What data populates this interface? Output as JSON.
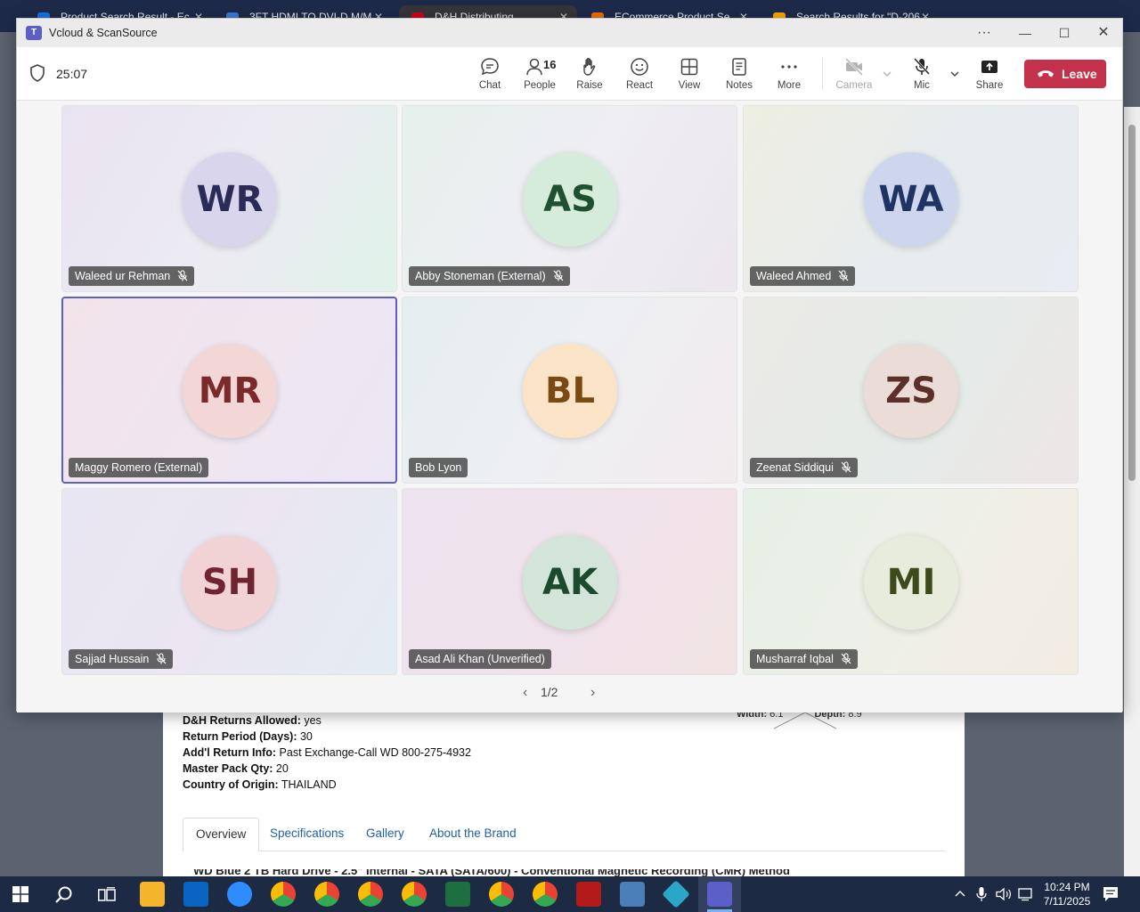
{
  "browser": {
    "tabs": [
      {
        "title": "Product Search Result - Ec",
        "color": "#1a73e8"
      },
      {
        "title": "3FT HDMI TO DVI-D M/M",
        "color": "#3a7bd5"
      },
      {
        "title": "D&H Distributing",
        "color": "#d0021b"
      },
      {
        "title": "ECommerce Product Se",
        "color": "#e8710a"
      },
      {
        "title": "Search Results for \"D-206",
        "color": "#f9ab00"
      }
    ]
  },
  "product_page": {
    "specs": [
      {
        "label": "D&H Returns Allowed:",
        "value": "yes"
      },
      {
        "label": "Return Period (Days):",
        "value": "30"
      },
      {
        "label": "Add'l Return Info:",
        "value": "Past Exchange-Call WD 800-275-4932"
      },
      {
        "label": "Master Pack Qty:",
        "value": "20"
      },
      {
        "label": "Country of Origin:",
        "value": "THAILAND"
      }
    ],
    "dimensions": {
      "width_label": "Width:",
      "width_value": "6.1\"",
      "depth_label": "Depth:",
      "depth_value": "8.9\""
    },
    "tabs": [
      "Overview",
      "Specifications",
      "Gallery",
      "About the Brand"
    ],
    "cut_title": "WD Blue 2 TB Hard Drive - 2.5\" Internal - SATA (SATA/600) - Conventional Magnetic Recording (CMR) Method"
  },
  "teams": {
    "window_title": "Vcloud & ScanSource",
    "more_options": "···",
    "timer": "25:07",
    "toolbar": {
      "chat": "Chat",
      "people": "People",
      "people_count": "16",
      "raise": "Raise",
      "react": "React",
      "view": "View",
      "notes": "Notes",
      "more": "More",
      "camera": "Camera",
      "mic": "Mic",
      "share": "Share",
      "leave": "Leave"
    },
    "participants": [
      {
        "initials": "WR",
        "name": "Waleed ur Rehman",
        "muted": true,
        "bg": "#d8d5ec",
        "fg": "#2b2b57"
      },
      {
        "initials": "AS",
        "name": "Abby Stoneman (External)",
        "muted": true,
        "bg": "#d4ecd9",
        "fg": "#1f5131"
      },
      {
        "initials": "WA",
        "name": "Waleed Ahmed",
        "muted": true,
        "bg": "#cdd6ec",
        "fg": "#1f3463"
      },
      {
        "initials": "MR",
        "name": "Maggy Romero (External)",
        "muted": false,
        "bg": "#f3d6d6",
        "fg": "#7a2a2a"
      },
      {
        "initials": "BL",
        "name": "Bob Lyon",
        "muted": false,
        "bg": "#fbe3c8",
        "fg": "#7a4a14"
      },
      {
        "initials": "ZS",
        "name": "Zeenat Siddiqui",
        "muted": true,
        "bg": "#ecdcd8",
        "fg": "#5a3029"
      },
      {
        "initials": "SH",
        "name": "Sajjad Hussain",
        "muted": true,
        "bg": "#f1d3d6",
        "fg": "#6e2431"
      },
      {
        "initials": "AK",
        "name": "Asad Ali Khan (Unverified)",
        "muted": false,
        "bg": "#d2e5d8",
        "fg": "#1d4a2c"
      },
      {
        "initials": "MI",
        "name": "Musharraf Iqbal",
        "muted": true,
        "bg": "#e8ecdc",
        "fg": "#3c4a1c"
      }
    ],
    "pager": "1/2"
  },
  "taskbar": {
    "time": "10:24 PM",
    "date": "7/11/2025"
  }
}
